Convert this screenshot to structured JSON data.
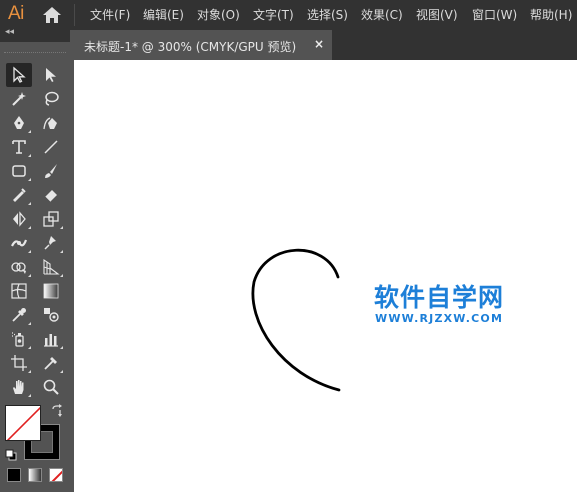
{
  "app": {
    "logo": "Ai",
    "home_icon": "home-icon"
  },
  "menu": [
    "文件(F)",
    "编辑(E)",
    "对象(O)",
    "文字(T)",
    "选择(S)",
    "效果(C)",
    "视图(V)",
    "窗口(W)",
    "帮助(H)"
  ],
  "document": {
    "tab_title": "未标题-1* @ 300% (CMYK/GPU 预览)",
    "close_glyph": "×"
  },
  "panel": {
    "collapse_glyph": "◂◂"
  },
  "tools": [
    {
      "name": "selection-tool-icon",
      "active": true
    },
    {
      "name": "direct-selection-tool-icon"
    },
    {
      "name": "magic-wand-tool-icon"
    },
    {
      "name": "lasso-tool-icon"
    },
    {
      "name": "pen-tool-icon"
    },
    {
      "name": "curvature-tool-icon"
    },
    {
      "name": "type-tool-icon"
    },
    {
      "name": "line-segment-tool-icon"
    },
    {
      "name": "rectangle-tool-icon"
    },
    {
      "name": "paintbrush-tool-icon"
    },
    {
      "name": "shaper-tool-icon"
    },
    {
      "name": "eraser-tool-icon"
    },
    {
      "name": "rotate-tool-icon"
    },
    {
      "name": "scale-tool-icon"
    },
    {
      "name": "width-tool-icon"
    },
    {
      "name": "puppet-warp-tool-icon"
    },
    {
      "name": "shape-builder-tool-icon"
    },
    {
      "name": "perspective-grid-tool-icon"
    },
    {
      "name": "mesh-tool-icon"
    },
    {
      "name": "gradient-tool-icon"
    },
    {
      "name": "eyedropper-tool-icon"
    },
    {
      "name": "blend-tool-icon"
    },
    {
      "name": "symbol-sprayer-tool-icon"
    },
    {
      "name": "column-graph-tool-icon"
    },
    {
      "name": "artboard-tool-icon"
    },
    {
      "name": "slice-tool-icon"
    },
    {
      "name": "hand-tool-icon"
    },
    {
      "name": "zoom-tool-icon"
    }
  ],
  "colors": {
    "fill": "#ffffff",
    "stroke": "#000000",
    "none_slash": "#e02020",
    "app_accent": "#e8913f",
    "watermark": "#1d7fd8"
  },
  "watermark": {
    "title": "软件自学网",
    "url": "WWW.RJZXW.COM"
  }
}
